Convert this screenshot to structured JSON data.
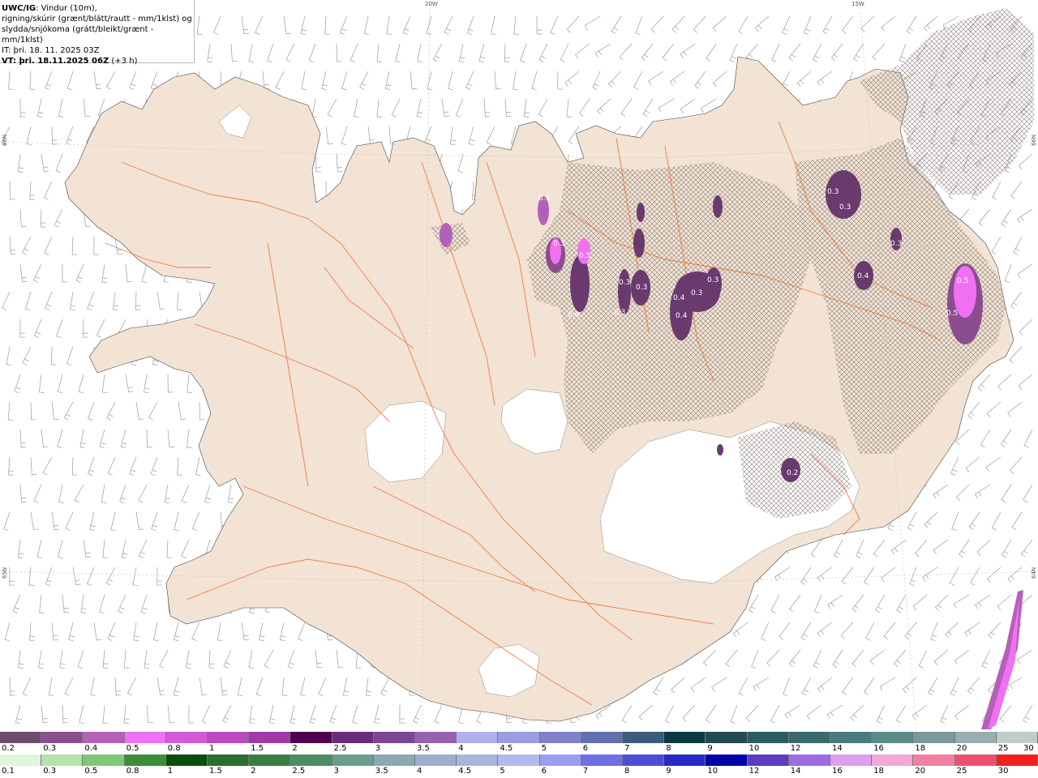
{
  "header": {
    "product": "UWC/IG",
    "line1_rest": ": Vindur (10m),",
    "line2": "rigning/skúrir (grænt/blátt/rautt - mm/1klst) og",
    "line3": "slydda/snjókoma (grátt/bleikt/grænt - mm/1klst)",
    "it_label": "IT",
    "it_value": ": þri. 18. 11. 2025 03Z",
    "vt_label": "VT",
    "vt_value": ": þri. 18.11.2025 06Z",
    "vt_lead": "(+3 h)"
  },
  "grid_labels": {
    "top_20w": "20W",
    "top_15w": "15W",
    "left_66n": "66N",
    "left_65n": "65N",
    "right_66n": "66N",
    "right_64n": "64N"
  },
  "map_labels": [
    "0.3",
    "0.3",
    "0.3",
    "0.4",
    "0.3",
    "0.3",
    "0.3",
    "0.3",
    "0.4",
    "0.4",
    "0.3",
    "0.5",
    "0.5",
    "0.2",
    "0.5",
    "0.4",
    "0.3",
    "0.3"
  ],
  "colors": {
    "land": "#f2e3d4",
    "road": "#f06a2e",
    "glacier": "#ffffff",
    "sea": "#ffffff",
    "hatch": "#8c7f79",
    "precip_dark": "#6a3a6e",
    "precip_light": "#e36ee8"
  },
  "legend_snow": {
    "ticks": [
      "0.2",
      "0.3",
      "0.4",
      "0.5",
      "0.8",
      "1",
      "1.5",
      "2",
      "2.5",
      "3",
      "3.5",
      "4",
      "4.5",
      "5",
      "6",
      "7",
      "8",
      "9",
      "10",
      "12",
      "14",
      "16",
      "18",
      "20",
      "25",
      "30"
    ],
    "colors": [
      "#6d4b6e",
      "#8a4d8e",
      "#b560b8",
      "#f070f2",
      "#d55ad8",
      "#b94ac0",
      "#a03aa8",
      "#500050",
      "#6a2c78",
      "#7d4494",
      "#9860b0",
      "#b0b0f0",
      "#9c9ce0",
      "#8080cc",
      "#6070b0",
      "#3c5a7c",
      "#0c3a44",
      "#234c50",
      "#2c5c60",
      "#3a6a6c",
      "#4c7a7c",
      "#5c8a88",
      "#7a9a98",
      "#98aeb0",
      "#c0cccc"
    ]
  },
  "legend_rain": {
    "ticks": [
      "0.1",
      "0.3",
      "0.5",
      "0.8",
      "1",
      "1.5",
      "2",
      "2.5",
      "3",
      "3.5",
      "4",
      "4.5",
      "5",
      "6",
      "7",
      "8",
      "9",
      "10",
      "12",
      "14",
      "16",
      "18",
      "20",
      "25",
      "30"
    ],
    "colors": [
      "#dff5dc",
      "#b4e4ac",
      "#80c878",
      "#3c8c3c",
      "#0c4c0c",
      "#2c6c30",
      "#3c7c44",
      "#4c8c64",
      "#6c9c8c",
      "#8ca8b0",
      "#9cb0cc",
      "#a8b4dc",
      "#b4b8ec",
      "#9c9cf4",
      "#7070e4",
      "#4c4cd4",
      "#2828c4",
      "#0000a8",
      "#5c3cc0",
      "#9c6ce0",
      "#dca0ec",
      "#f4a8d8",
      "#f080a0",
      "#f05070",
      "#f02020"
    ]
  }
}
